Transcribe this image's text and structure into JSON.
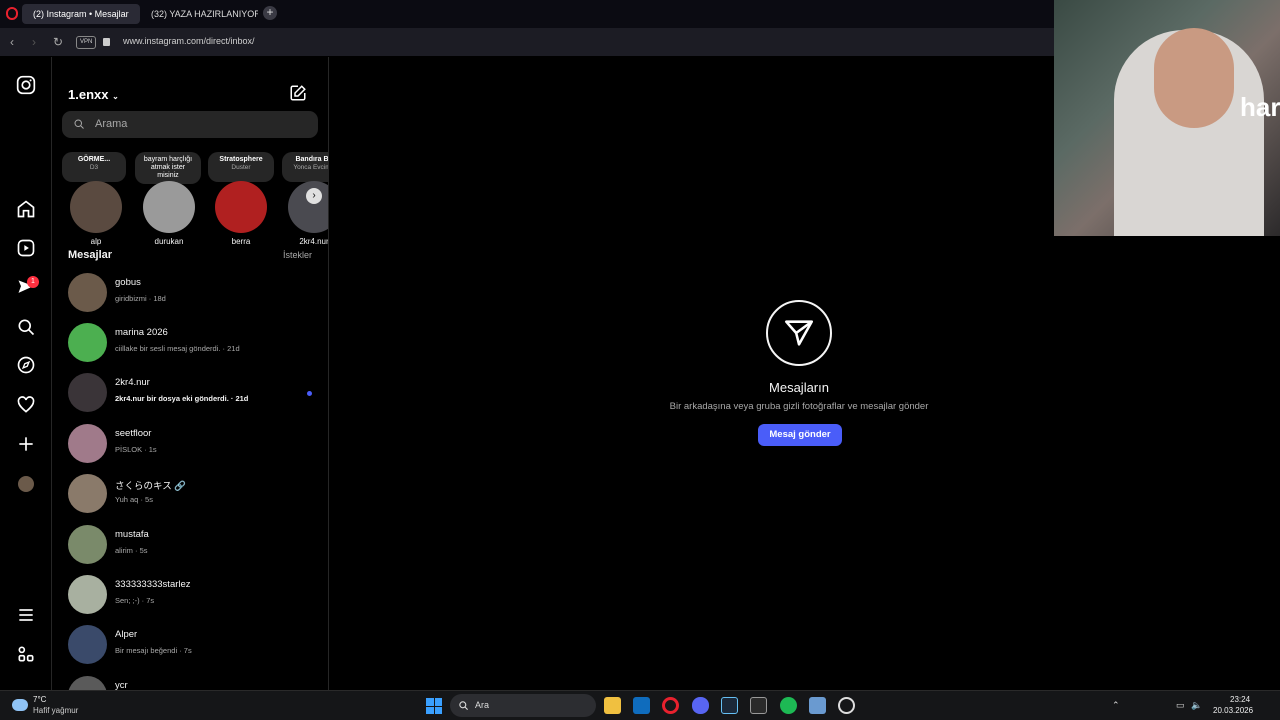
{
  "browser": {
    "tabs": [
      {
        "title": "(2) Instagram • Mesajlar",
        "active": true
      },
      {
        "title": "(32) YAZA HAZIRLANIYORUZ"
      }
    ],
    "close_glyph": "×",
    "new_tab_glyph": "+",
    "vpn_label": "VPN",
    "url": "www.instagram.com/direct/inbox/"
  },
  "rail": {
    "notification_count": "1"
  },
  "panel": {
    "account": "1.enxx",
    "search_placeholder": "Arama",
    "notes": [
      {
        "title": "GÖRME...",
        "sub": "D3"
      },
      {
        "title": "bayram harçlığı atmak ister misiniz",
        "sub": ""
      },
      {
        "title": "Stratosphere",
        "sub": "Duster"
      },
      {
        "title": "Bandıra B",
        "sub": "Yonca Evcim"
      }
    ],
    "stories": [
      "alp",
      "durukan",
      "berra",
      "2kr4.nur"
    ],
    "section_title": "Mesajlar",
    "requests_label": "İstekler",
    "conversations": [
      {
        "name": "gobus",
        "preview": "giridbizmi · 18d",
        "color": "#6b5a4a"
      },
      {
        "name": "marina 2026",
        "preview": "ciillake bir sesli mesaj gönderdi. · 21d",
        "color": "#4caf50"
      },
      {
        "name": "2kr4.nur",
        "preview": "2kr4.nur bir dosya eki gönderdi. · 21d",
        "color": "#3a3438",
        "unread": true
      },
      {
        "name": "seetfloor",
        "preview": "PİSLOK · 1s",
        "color": "#a07a8a"
      },
      {
        "name": "さくらのキス 🔗",
        "preview": "Yuh aq · 5s",
        "color": "#8a7a6a"
      },
      {
        "name": "mustafa",
        "preview": "alirim · 5s",
        "color": "#7a8a6a"
      },
      {
        "name": "333333333starlez",
        "preview": "Sen; ;-) · 7s",
        "color": "#a8b0a0"
      },
      {
        "name": "Alper",
        "preview": "Bir mesajı beğendi · 7s",
        "color": "#3a4a6a"
      },
      {
        "name": "ycr",
        "preview": "",
        "color": "#5a5a5a"
      }
    ]
  },
  "main": {
    "title": "Mesajların",
    "subtitle": "Bir arkadaşına veya gruba gizli fotoğraflar ve mesajlar gönder",
    "button": "Mesaj gönder"
  },
  "webcam": {
    "overlay_text": "har"
  },
  "taskbar": {
    "weather_temp": "7°C",
    "weather_desc": "Hafif yağmur",
    "search_placeholder": "Ara",
    "time": "23:24",
    "date": "20.03.2026"
  }
}
